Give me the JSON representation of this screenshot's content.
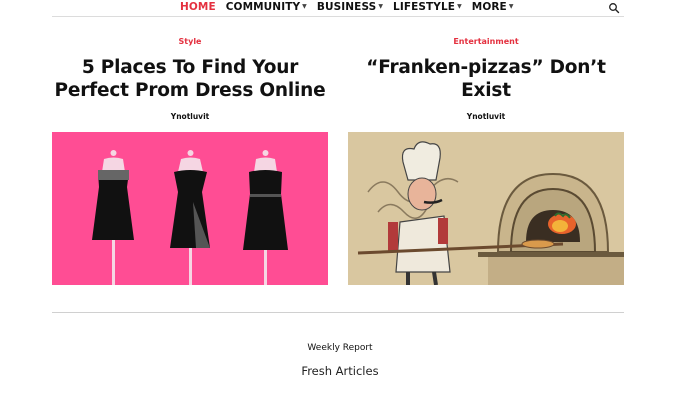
{
  "nav": {
    "items": [
      {
        "label": "HOME",
        "active": true,
        "dropdown": false
      },
      {
        "label": "COMMUNITY",
        "active": false,
        "dropdown": true
      },
      {
        "label": "BUSINESS",
        "active": false,
        "dropdown": true
      },
      {
        "label": "LIFESTYLE",
        "active": false,
        "dropdown": true
      },
      {
        "label": "MORE",
        "active": false,
        "dropdown": true
      }
    ],
    "search_icon": "search-icon"
  },
  "articles": [
    {
      "category": "Style",
      "title": "5 Places To Find Your Perfect Prom Dress Online",
      "author": "Ynotluvit",
      "image": "three-black-dresses-on-pink"
    },
    {
      "category": "Entertainment",
      "title": "“Franken-pizzas” Don’t Exist",
      "author": "Ynotluvit",
      "image": "chef-at-pizza-oven-drawing"
    }
  ],
  "footer": {
    "weekly_label": "Weekly Report",
    "fresh_label": "Fresh Articles"
  },
  "colors": {
    "accent": "#e4303f",
    "pink_bg": "#ff4d94",
    "sepia_bg": "#d9c7a0"
  }
}
